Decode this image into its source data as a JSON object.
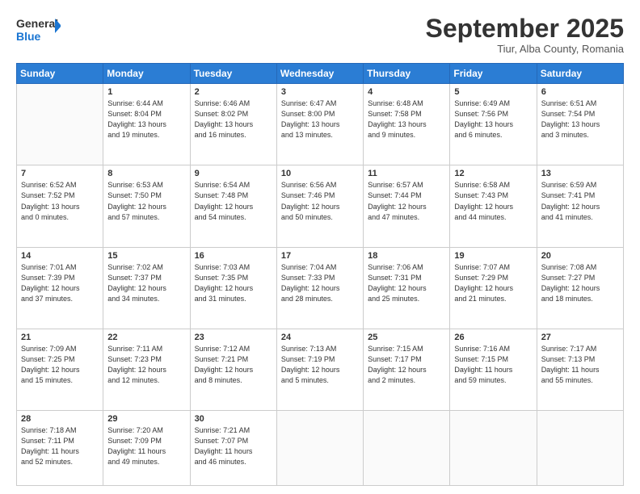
{
  "header": {
    "logo_line1": "General",
    "logo_line2": "Blue",
    "month": "September 2025",
    "location": "Tiur, Alba County, Romania"
  },
  "weekdays": [
    "Sunday",
    "Monday",
    "Tuesday",
    "Wednesday",
    "Thursday",
    "Friday",
    "Saturday"
  ],
  "weeks": [
    [
      {
        "day": "",
        "info": ""
      },
      {
        "day": "1",
        "info": "Sunrise: 6:44 AM\nSunset: 8:04 PM\nDaylight: 13 hours\nand 19 minutes."
      },
      {
        "day": "2",
        "info": "Sunrise: 6:46 AM\nSunset: 8:02 PM\nDaylight: 13 hours\nand 16 minutes."
      },
      {
        "day": "3",
        "info": "Sunrise: 6:47 AM\nSunset: 8:00 PM\nDaylight: 13 hours\nand 13 minutes."
      },
      {
        "day": "4",
        "info": "Sunrise: 6:48 AM\nSunset: 7:58 PM\nDaylight: 13 hours\nand 9 minutes."
      },
      {
        "day": "5",
        "info": "Sunrise: 6:49 AM\nSunset: 7:56 PM\nDaylight: 13 hours\nand 6 minutes."
      },
      {
        "day": "6",
        "info": "Sunrise: 6:51 AM\nSunset: 7:54 PM\nDaylight: 13 hours\nand 3 minutes."
      }
    ],
    [
      {
        "day": "7",
        "info": "Sunrise: 6:52 AM\nSunset: 7:52 PM\nDaylight: 13 hours\nand 0 minutes."
      },
      {
        "day": "8",
        "info": "Sunrise: 6:53 AM\nSunset: 7:50 PM\nDaylight: 12 hours\nand 57 minutes."
      },
      {
        "day": "9",
        "info": "Sunrise: 6:54 AM\nSunset: 7:48 PM\nDaylight: 12 hours\nand 54 minutes."
      },
      {
        "day": "10",
        "info": "Sunrise: 6:56 AM\nSunset: 7:46 PM\nDaylight: 12 hours\nand 50 minutes."
      },
      {
        "day": "11",
        "info": "Sunrise: 6:57 AM\nSunset: 7:44 PM\nDaylight: 12 hours\nand 47 minutes."
      },
      {
        "day": "12",
        "info": "Sunrise: 6:58 AM\nSunset: 7:43 PM\nDaylight: 12 hours\nand 44 minutes."
      },
      {
        "day": "13",
        "info": "Sunrise: 6:59 AM\nSunset: 7:41 PM\nDaylight: 12 hours\nand 41 minutes."
      }
    ],
    [
      {
        "day": "14",
        "info": "Sunrise: 7:01 AM\nSunset: 7:39 PM\nDaylight: 12 hours\nand 37 minutes."
      },
      {
        "day": "15",
        "info": "Sunrise: 7:02 AM\nSunset: 7:37 PM\nDaylight: 12 hours\nand 34 minutes."
      },
      {
        "day": "16",
        "info": "Sunrise: 7:03 AM\nSunset: 7:35 PM\nDaylight: 12 hours\nand 31 minutes."
      },
      {
        "day": "17",
        "info": "Sunrise: 7:04 AM\nSunset: 7:33 PM\nDaylight: 12 hours\nand 28 minutes."
      },
      {
        "day": "18",
        "info": "Sunrise: 7:06 AM\nSunset: 7:31 PM\nDaylight: 12 hours\nand 25 minutes."
      },
      {
        "day": "19",
        "info": "Sunrise: 7:07 AM\nSunset: 7:29 PM\nDaylight: 12 hours\nand 21 minutes."
      },
      {
        "day": "20",
        "info": "Sunrise: 7:08 AM\nSunset: 7:27 PM\nDaylight: 12 hours\nand 18 minutes."
      }
    ],
    [
      {
        "day": "21",
        "info": "Sunrise: 7:09 AM\nSunset: 7:25 PM\nDaylight: 12 hours\nand 15 minutes."
      },
      {
        "day": "22",
        "info": "Sunrise: 7:11 AM\nSunset: 7:23 PM\nDaylight: 12 hours\nand 12 minutes."
      },
      {
        "day": "23",
        "info": "Sunrise: 7:12 AM\nSunset: 7:21 PM\nDaylight: 12 hours\nand 8 minutes."
      },
      {
        "day": "24",
        "info": "Sunrise: 7:13 AM\nSunset: 7:19 PM\nDaylight: 12 hours\nand 5 minutes."
      },
      {
        "day": "25",
        "info": "Sunrise: 7:15 AM\nSunset: 7:17 PM\nDaylight: 12 hours\nand 2 minutes."
      },
      {
        "day": "26",
        "info": "Sunrise: 7:16 AM\nSunset: 7:15 PM\nDaylight: 11 hours\nand 59 minutes."
      },
      {
        "day": "27",
        "info": "Sunrise: 7:17 AM\nSunset: 7:13 PM\nDaylight: 11 hours\nand 55 minutes."
      }
    ],
    [
      {
        "day": "28",
        "info": "Sunrise: 7:18 AM\nSunset: 7:11 PM\nDaylight: 11 hours\nand 52 minutes."
      },
      {
        "day": "29",
        "info": "Sunrise: 7:20 AM\nSunset: 7:09 PM\nDaylight: 11 hours\nand 49 minutes."
      },
      {
        "day": "30",
        "info": "Sunrise: 7:21 AM\nSunset: 7:07 PM\nDaylight: 11 hours\nand 46 minutes."
      },
      {
        "day": "",
        "info": ""
      },
      {
        "day": "",
        "info": ""
      },
      {
        "day": "",
        "info": ""
      },
      {
        "day": "",
        "info": ""
      }
    ]
  ]
}
